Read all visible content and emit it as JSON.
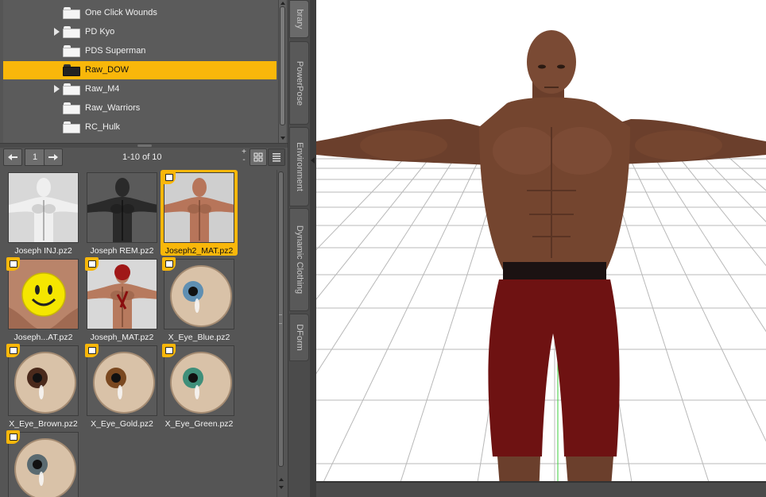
{
  "tree": {
    "items": [
      {
        "label": "One Click Wounds",
        "expandable": false,
        "selected": false
      },
      {
        "label": "PD Kyo",
        "expandable": true,
        "selected": false
      },
      {
        "label": "PDS Superman",
        "expandable": false,
        "selected": false
      },
      {
        "label": "Raw_DOW",
        "expandable": false,
        "selected": true
      },
      {
        "label": "Raw_M4",
        "expandable": true,
        "selected": false
      },
      {
        "label": "Raw_Warriors",
        "expandable": false,
        "selected": false
      },
      {
        "label": "RC_Hulk",
        "expandable": false,
        "selected": false
      }
    ]
  },
  "pager": {
    "prev_icon": "arrow-left-icon",
    "next_icon": "arrow-right-icon",
    "page": "1",
    "count_label": "1-10 of 10",
    "zoom_in": "+",
    "zoom_out": "-",
    "grid_view_icon": "grid-view-icon",
    "list_view_icon": "list-view-icon"
  },
  "thumbnails": [
    {
      "label": "Joseph INJ.pz2",
      "badge": false,
      "selected": false,
      "image": "white-figure"
    },
    {
      "label": "Joseph REM.pz2",
      "badge": false,
      "selected": false,
      "image": "dark-figure"
    },
    {
      "label": "Joseph2_MAT.pz2",
      "badge": true,
      "selected": true,
      "image": "skin-figure"
    },
    {
      "label": "Joseph...AT.pz2",
      "badge": true,
      "selected": false,
      "image": "smiley"
    },
    {
      "label": "Joseph_MAT.pz2",
      "badge": true,
      "selected": false,
      "image": "wounded-figure"
    },
    {
      "label": "X_Eye_Blue.pz2",
      "badge": true,
      "selected": false,
      "image": "eye",
      "iris": "#5f8fb2"
    },
    {
      "label": "X_Eye_Brown.pz2",
      "badge": true,
      "selected": false,
      "image": "eye",
      "iris": "#4a2a1c"
    },
    {
      "label": "X_Eye_Gold.pz2",
      "badge": true,
      "selected": false,
      "image": "eye",
      "iris": "#7a4820"
    },
    {
      "label": "X_Eye_Green.pz2",
      "badge": true,
      "selected": false,
      "image": "eye",
      "iris": "#3f8f7a"
    },
    {
      "label": "",
      "badge": true,
      "selected": false,
      "image": "eye",
      "iris": "#5a6a70"
    }
  ],
  "side_tabs": [
    {
      "label": "brary",
      "active": true
    },
    {
      "label": "PowerPose",
      "active": false
    },
    {
      "label": "Environment",
      "active": false
    },
    {
      "label": "Dynamic Clothing",
      "active": false
    },
    {
      "label": "DForm",
      "active": false
    }
  ],
  "colors": {
    "accent": "#f9b70a",
    "panel": "#555555",
    "skin": "#7a4a34",
    "shorts": "#6e1212"
  },
  "icons": {
    "folder": "folder-icon",
    "expand": "expand-arrow-icon",
    "material_badge": "material-preset-badge-icon"
  }
}
